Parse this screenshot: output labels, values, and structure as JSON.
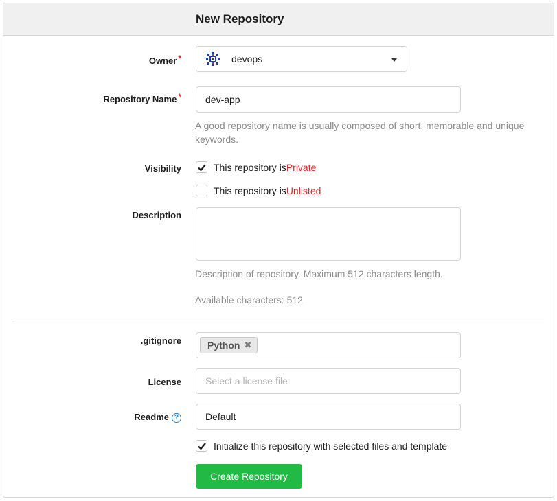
{
  "header": {
    "title": "New Repository"
  },
  "owner": {
    "label": "Owner",
    "required_mark": "*",
    "value": "devops"
  },
  "repo_name": {
    "label": "Repository Name",
    "required_mark": "*",
    "value": "dev-app",
    "help": "A good repository name is usually composed of short, memorable and unique keywords."
  },
  "visibility": {
    "label": "Visibility",
    "private_prefix": "This repository is ",
    "private_word": "Private",
    "private_checked": true,
    "unlisted_prefix": "This repository is ",
    "unlisted_word": "Unlisted",
    "unlisted_checked": false
  },
  "description": {
    "label": "Description",
    "value": "",
    "help": "Description of repository. Maximum 512 characters length.",
    "available": "Available characters: 512"
  },
  "gitignore": {
    "label": ".gitignore",
    "selected": [
      "Python"
    ]
  },
  "license": {
    "label": "License",
    "placeholder": "Select a license file"
  },
  "readme": {
    "label": "Readme",
    "help_icon": "?",
    "value": "Default"
  },
  "init": {
    "label": "Initialize this repository with selected files and template",
    "checked": true
  },
  "submit": {
    "label": "Create Repository"
  },
  "colors": {
    "accent": "#21ba45",
    "required": "#db2828",
    "link": "#2185d0"
  },
  "icons": {
    "avatar": "snowflake-avatar-icon",
    "check": "check-icon",
    "remove": "remove-icon",
    "help": "help-circle-icon",
    "caret": "caret-down-icon"
  }
}
